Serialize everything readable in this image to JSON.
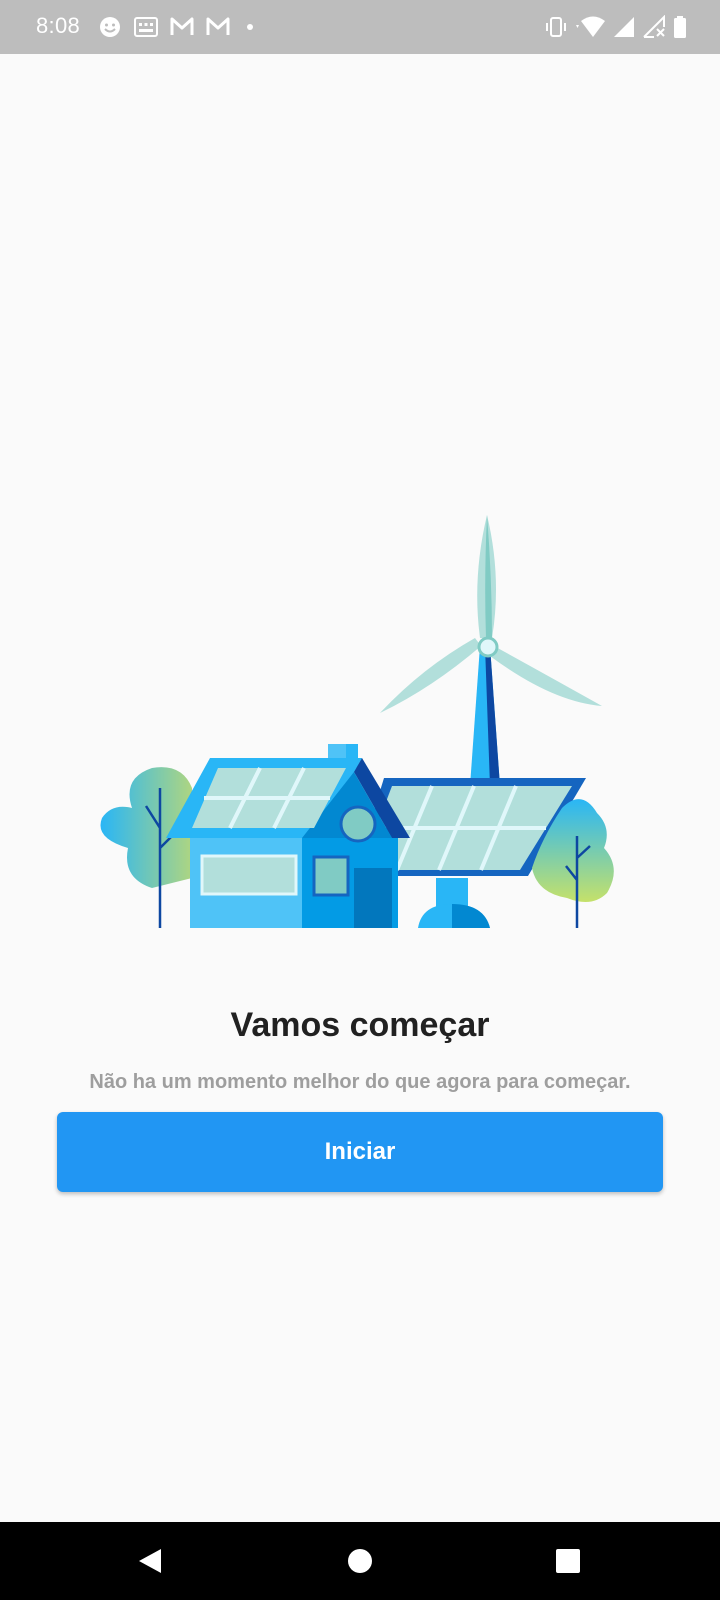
{
  "status_bar": {
    "time": "8:08",
    "left_icons": [
      "face-icon",
      "calendar-icon",
      "gmail-icon",
      "gmail-icon",
      "dot-icon"
    ],
    "right_icons": [
      "vibrate-icon",
      "wifi-icon",
      "signal-icon",
      "signal-no-data-icon",
      "battery-icon"
    ]
  },
  "main": {
    "title": "Vamos começar",
    "subtitle": "Não ha um momento melhor do que agora para começar.",
    "start_button_label": "Iniciar"
  },
  "nav_bar": {
    "buttons": [
      "back-icon",
      "home-icon",
      "recents-icon"
    ]
  },
  "colors": {
    "status_bar": "#bdbdbd",
    "background": "#fafafa",
    "primary": "#2196f3",
    "title_text": "#212121",
    "subtitle_text": "#9e9e9e"
  }
}
